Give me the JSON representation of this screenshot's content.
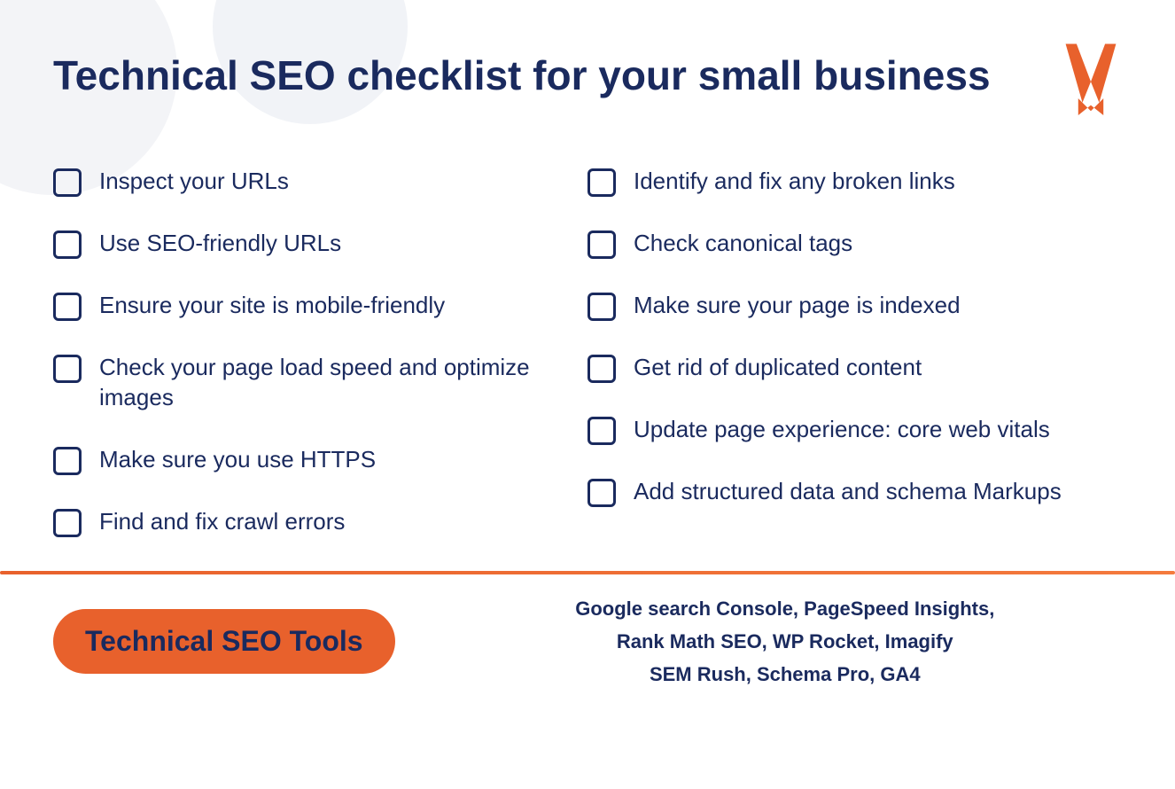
{
  "page": {
    "title": "Technical SEO checklist for your small business",
    "background_color": "#ffffff",
    "accent_color": "#e8612c",
    "text_color": "#1a2a5e"
  },
  "checklist": {
    "left_column": [
      {
        "id": 1,
        "text": "Inspect your URLs"
      },
      {
        "id": 2,
        "text": "Use SEO-friendly URLs"
      },
      {
        "id": 3,
        "text": "Ensure your site is mobile-friendly"
      },
      {
        "id": 4,
        "text": "Check your page load speed and optimize images"
      },
      {
        "id": 5,
        "text": "Make sure you use HTTPS"
      },
      {
        "id": 6,
        "text": "Find and fix crawl errors"
      }
    ],
    "right_column": [
      {
        "id": 7,
        "text": "Identify and fix any broken links"
      },
      {
        "id": 8,
        "text": "Check canonical tags"
      },
      {
        "id": 9,
        "text": "Make sure your page is indexed"
      },
      {
        "id": 10,
        "text": "Get rid of duplicated content"
      },
      {
        "id": 11,
        "text": "Update page experience: core web vitals"
      },
      {
        "id": 12,
        "text": "Add structured data and schema Markups"
      }
    ]
  },
  "footer": {
    "badge_label": "Technical SEO Tools",
    "tools_line1": "Google search Console, PageSpeed Insights,",
    "tools_line2": "Rank Math SEO, WP Rocket, Imagify",
    "tools_line3": "SEM Rush, Schema Pro, GA4"
  }
}
